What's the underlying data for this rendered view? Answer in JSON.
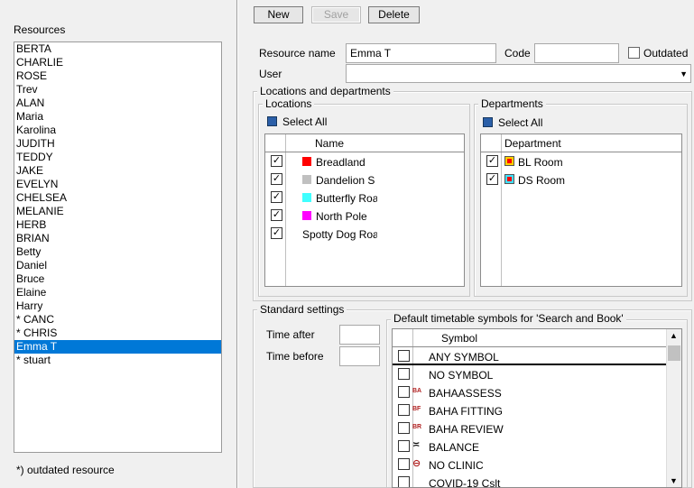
{
  "left": {
    "heading": "Resources",
    "footnote": "*) outdated resource",
    "items": [
      "BERTA",
      "CHARLIE",
      "ROSE",
      "Trev",
      "ALAN",
      "Maria",
      "Karolina",
      "JUDITH",
      "TEDDY",
      "JAKE",
      "EVELYN",
      "CHELSEA",
      "MELANIE",
      "HERB",
      "BRIAN",
      "Betty",
      "Daniel",
      "Bruce",
      "Elaine",
      "Harry",
      "* CANC",
      "* CHRIS",
      "Emma T",
      "* stuart"
    ],
    "selected_index": 22
  },
  "toolbar": {
    "new_label": "New",
    "save_label": "Save",
    "delete_label": "Delete"
  },
  "form": {
    "resource_name_label": "Resource name",
    "resource_name_value": "Emma T",
    "code_label": "Code",
    "code_value": "",
    "outdated_label": "Outdated",
    "user_label": "User",
    "user_value": ""
  },
  "locdep": {
    "title": "Locations and departments",
    "locations": {
      "title": "Locations",
      "select_all": "Select All",
      "column": "Name",
      "rows": [
        {
          "name": "Breadland",
          "color": "#ff0000",
          "checked": true
        },
        {
          "name": "Dandelion S",
          "color": "#c0c0c0",
          "checked": true
        },
        {
          "name": "Butterfly Roa",
          "color": "#40ffff",
          "checked": true
        },
        {
          "name": "North Pole",
          "color": "#ff00ff",
          "checked": true
        },
        {
          "name": "Spotty Dog Roa",
          "color": "",
          "checked": true
        }
      ]
    },
    "departments": {
      "title": "Departments",
      "select_all": "Select All",
      "column": "Department",
      "rows": [
        {
          "name": "BL Room",
          "color": "#ffd000",
          "inner": "#ff0000",
          "checked": true
        },
        {
          "name": "DS Room",
          "color": "#40e0ff",
          "inner": "#ff0000",
          "checked": true
        }
      ]
    }
  },
  "standard": {
    "title": "Standard settings",
    "time_after_label": "Time after",
    "time_after_value": "",
    "time_before_label": "Time before",
    "time_before_value": "",
    "symbols": {
      "title": "Default timetable symbols for 'Search and Book'",
      "column": "Symbol",
      "rows": [
        {
          "name": "ANY SYMBOL",
          "icon": ""
        },
        {
          "name": "NO SYMBOL",
          "icon": ""
        },
        {
          "name": "BAHAASSESS",
          "icon": "BA"
        },
        {
          "name": "BAHA FITTING",
          "icon": "BF"
        },
        {
          "name": "BAHA REVIEW",
          "icon": "BR"
        },
        {
          "name": "BALANCE",
          "icon": "≍"
        },
        {
          "name": "NO CLINIC",
          "icon": "⊖"
        },
        {
          "name": "COVID-19 Cslt",
          "icon": ""
        }
      ]
    }
  }
}
